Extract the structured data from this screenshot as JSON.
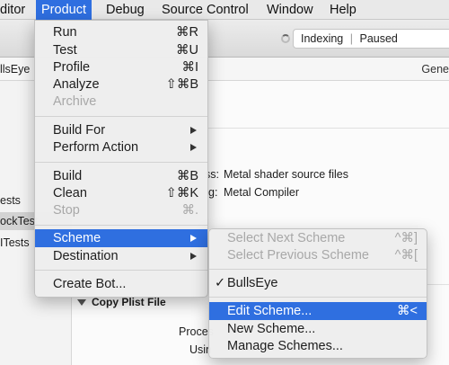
{
  "menubar": {
    "items": [
      {
        "label": "ditor"
      },
      {
        "label": "Product"
      },
      {
        "label": "Debug"
      },
      {
        "label": "Source Control"
      },
      {
        "label": "Window"
      },
      {
        "label": "Help"
      }
    ]
  },
  "toolbar": {
    "activity": {
      "status": "Indexing",
      "separator": "|",
      "state": "Paused"
    }
  },
  "jumpbar": {
    "crumb": "llsEye",
    "tab_general": "Gene"
  },
  "navigator": {
    "items": [
      {
        "label": "ests"
      },
      {
        "label": "ockTest"
      },
      {
        "label": "ITests"
      }
    ]
  },
  "editor": {
    "build_rules": [
      {
        "label": "ss:",
        "value": "Metal shader source files"
      },
      {
        "label": "g:",
        "value": "Metal Compiler"
      }
    ],
    "phase_title": "Copy Plist File",
    "row_labels": [
      "Proces",
      "Usin"
    ]
  },
  "product_menu": {
    "items": [
      {
        "label": "Run",
        "shortcut": "⌘R",
        "disabled": false
      },
      {
        "label": "Test",
        "shortcut": "⌘U",
        "disabled": false
      },
      {
        "label": "Profile",
        "shortcut": "⌘I",
        "disabled": false
      },
      {
        "label": "Analyze",
        "shortcut": "⇧⌘B",
        "disabled": false
      },
      {
        "label": "Archive",
        "shortcut": "",
        "disabled": true
      },
      {
        "label": "Build For",
        "submenu": true
      },
      {
        "label": "Perform Action",
        "submenu": true
      },
      {
        "label": "Build",
        "shortcut": "⌘B",
        "disabled": false
      },
      {
        "label": "Clean",
        "shortcut": "⇧⌘K",
        "disabled": false
      },
      {
        "label": "Stop",
        "shortcut": "⌘.",
        "disabled": true
      },
      {
        "label": "Scheme",
        "submenu": true,
        "highlighted": true
      },
      {
        "label": "Destination",
        "submenu": true
      },
      {
        "label": "Create Bot...",
        "shortcut": ""
      }
    ]
  },
  "scheme_menu": {
    "items": [
      {
        "label": "Select Next Scheme",
        "shortcut": "^⌘]",
        "disabled": true
      },
      {
        "label": "Select Previous Scheme",
        "shortcut": "^⌘[",
        "disabled": true
      },
      {
        "label": "BullsEye",
        "checked": true,
        "check_mark": "✓"
      },
      {
        "label": "Edit Scheme...",
        "shortcut": "⌘<",
        "highlighted": true
      },
      {
        "label": "New Scheme...",
        "shortcut": ""
      },
      {
        "label": "Manage Schemes...",
        "shortcut": ""
      }
    ]
  },
  "colors": {
    "accent": "#2f6fe0",
    "disabled_text": "#a8a8a8"
  }
}
